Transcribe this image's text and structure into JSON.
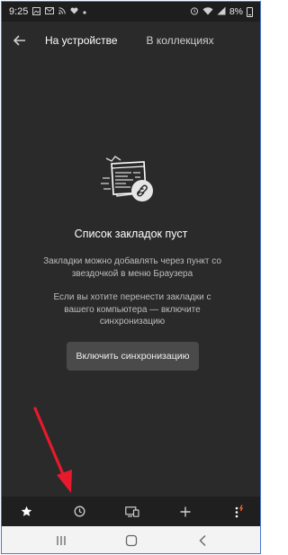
{
  "status_bar": {
    "time": "9:25",
    "left_icons": [
      "image-icon",
      "email-icon",
      "rss-icon",
      "heart-icon",
      "more-dots-icon"
    ],
    "right_icons": [
      "alarm-icon",
      "wifi-icon",
      "signal-icon"
    ],
    "battery": "8%"
  },
  "header": {
    "tabs": [
      {
        "label": "На устройстве",
        "active": true
      },
      {
        "label": "В коллекциях",
        "active": false
      }
    ]
  },
  "empty_state": {
    "title": "Список закладок пуст",
    "hint_1": "Закладки можно добавлять через пункт со звездочкой в меню Браузера",
    "hint_2": "Если вы хотите перенести закладки с вашего компьютера — включите синхронизацию",
    "sync_button": "Включить синхронизацию"
  },
  "toolbar": {
    "items": [
      "star-icon",
      "history-clock-icon",
      "devices-icon",
      "plus-icon",
      "menu-dots-icon"
    ]
  },
  "nav_bar": {
    "items": [
      "recents-icon",
      "home-icon",
      "back-icon"
    ]
  },
  "colors": {
    "background": "#2a2a2a",
    "toolbar": "#1f1f1f",
    "button": "#4a4a4a",
    "annotation_arrow": "#e8192c",
    "accent_orange": "#ff6a2f"
  }
}
